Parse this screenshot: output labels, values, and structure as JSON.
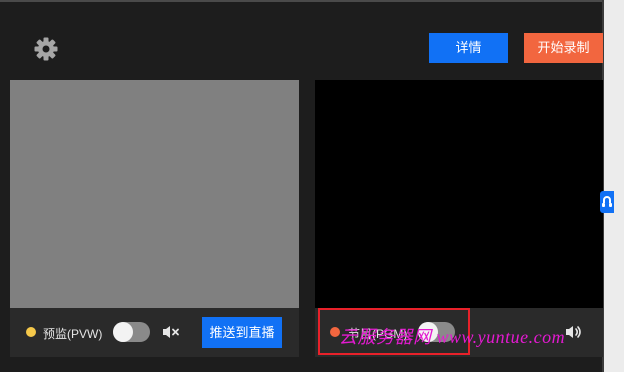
{
  "toolbar": {
    "settings_icon": "gear-icon",
    "detail_label": "详情",
    "record_label": "开始录制"
  },
  "preview": {
    "status_color": "#f5c84a",
    "label": "预监(PVW)",
    "toggle_on": false,
    "audio_icon": "speaker-muted-icon",
    "push_label": "推送到直播"
  },
  "program": {
    "status_color": "#f2663f",
    "label": "节目(PGM)",
    "toggle_on": false,
    "audio_icon": "speaker-on-icon"
  },
  "watermark": {
    "text": "云服务器网 www.yuntue.com",
    "color": "#e41ad1"
  },
  "side_tab_icon": "help-icon",
  "colors": {
    "accent": "#1171f5",
    "record": "#f2663f",
    "background": "#1d1d1d"
  }
}
